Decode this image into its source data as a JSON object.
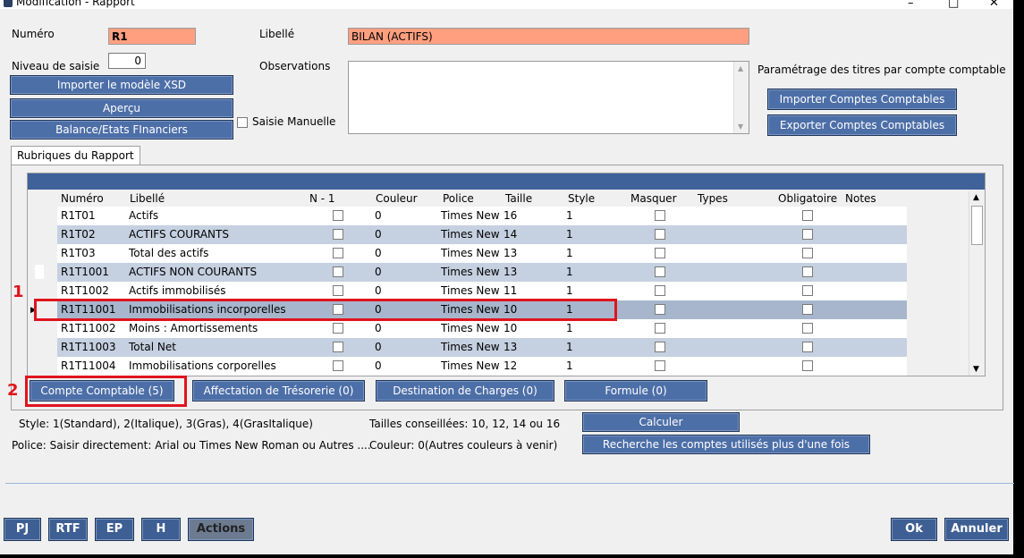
{
  "window": {
    "title": "Modification - Rapport"
  },
  "form": {
    "numero_label": "Numéro",
    "numero_value": "R1",
    "libelle_label": "Libellé",
    "libelle_value": "BILAN (ACTIFS)",
    "niveau_label": "Niveau de saisie",
    "niveau_value": "0",
    "observations_label": "Observations",
    "saisie_manuelle_label": "Saisie Manuelle",
    "parametrage_label": "Paramétrage des titres par compte comptable"
  },
  "buttons": {
    "importer_xsd": "Importer le modèle XSD",
    "apercu": "Aperçu",
    "balance": "Balance/Etats FInanciers",
    "importer_comptes": "Importer Comptes Comptables",
    "exporter_comptes": "Exporter Comptes Comptables",
    "compte_comptable": "Compte Comptable (5)",
    "affectation": "Affectation de Trésorerie (0)",
    "destination": "Destination de Charges (0)",
    "formule": "Formule (0)",
    "calculer": "Calculer",
    "recherche": "Recherche les comptes utilisés plus d'une fois",
    "pj": "PJ",
    "rtf": "RTF",
    "ep": "EP",
    "h": "H",
    "actions": "Actions",
    "ok": "Ok",
    "annuler": "Annuler"
  },
  "tab": {
    "label": "Rubriques du Rapport"
  },
  "grid": {
    "columns": [
      "Numéro",
      "Libellé",
      "N - 1",
      "Couleur",
      "Police",
      "Taille",
      "Style",
      "Masquer",
      "Types",
      "Obligatoire",
      "Notes"
    ],
    "rows": [
      {
        "numero": "R1T01",
        "libelle": "Actifs",
        "couleur": "0",
        "police": "Times New",
        "taille": "16",
        "style": "1"
      },
      {
        "numero": "R1T02",
        "libelle": "ACTIFS COURANTS",
        "couleur": "0",
        "police": "Times New",
        "taille": "14",
        "style": "1"
      },
      {
        "numero": "R1T03",
        "libelle": "Total des actifs",
        "couleur": "0",
        "police": "Times New",
        "taille": "13",
        "style": "1"
      },
      {
        "numero": "R1T1001",
        "libelle": "ACTIFS NON COURANTS",
        "couleur": "0",
        "police": "Times New",
        "taille": "13",
        "style": "1"
      },
      {
        "numero": "R1T1002",
        "libelle": "Actifs immobilisés",
        "couleur": "0",
        "police": "Times New",
        "taille": "11",
        "style": "1"
      },
      {
        "numero": "R1T11001",
        "libelle": "Immobilisations incorporelles",
        "couleur": "0",
        "police": "Times New",
        "taille": "10",
        "style": "1"
      },
      {
        "numero": "R1T11002",
        "libelle": "Moins : Amortissements",
        "couleur": "0",
        "police": "Times New",
        "taille": "10",
        "style": "1"
      },
      {
        "numero": "R1T11003",
        "libelle": "Total Net",
        "couleur": "0",
        "police": "Times New",
        "taille": "13",
        "style": "1"
      },
      {
        "numero": "R1T11004",
        "libelle": "Immobilisations corporelles",
        "couleur": "0",
        "police": "Times New",
        "taille": "12",
        "style": "1"
      }
    ]
  },
  "info": {
    "style_hint": "Style: 1(Standard), 2(Italique),  3(Gras), 4(GrasItalique)",
    "police_hint": "Police: Saisir directement: Arial ou Times New Roman ou Autres ....",
    "tailles_hint": "Tailles conseillées: 10, 12, 14 ou 16",
    "couleur_hint": "Couleur: 0(Autres couleurs à venir)"
  },
  "annotations": {
    "marker_1": "1",
    "marker_2": "2"
  },
  "colors": {
    "accent": "#4d6fa8",
    "required_field": "#ff9f80",
    "highlight": "#e0141e"
  }
}
